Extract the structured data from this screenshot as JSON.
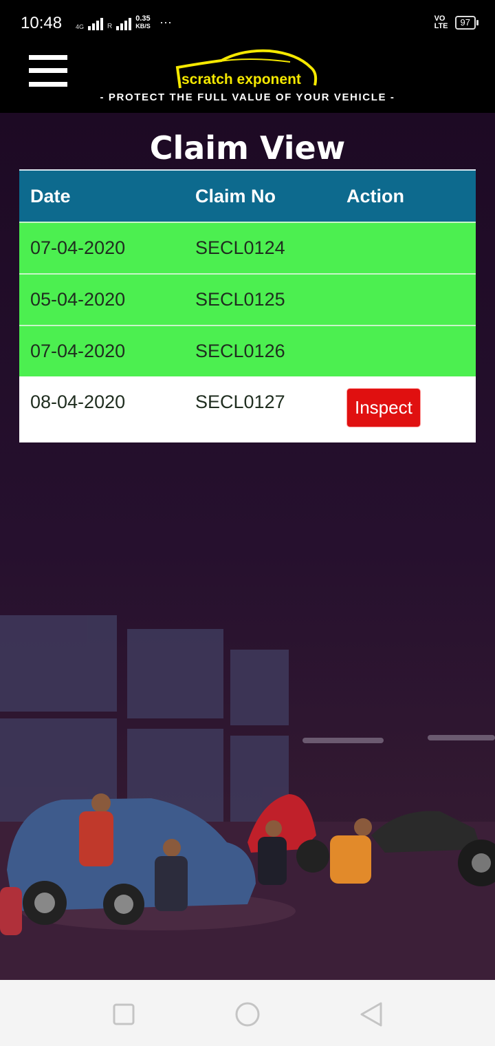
{
  "status_bar": {
    "time": "10:48",
    "network": "4G",
    "roaming": "R",
    "speed_value": "0.35",
    "speed_unit": "KB/S",
    "more": "···",
    "volte": "VO",
    "lte": "LTE",
    "battery": "97"
  },
  "header": {
    "logo_text": "scratch exponent",
    "tagline": "- PROTECT THE FULL VALUE OF YOUR VEHICLE -",
    "logo_color": "#f5e800"
  },
  "page": {
    "title": "Claim View"
  },
  "table": {
    "columns": [
      "Date",
      "Claim No",
      "Action"
    ],
    "rows": [
      {
        "date": "07-04-2020",
        "claim_no": "SECL0124",
        "action": ""
      },
      {
        "date": "05-04-2020",
        "claim_no": "SECL0125",
        "action": ""
      },
      {
        "date": "07-04-2020",
        "claim_no": "SECL0126",
        "action": ""
      },
      {
        "date": "08-04-2020",
        "claim_no": "SECL0127",
        "action": "Inspect"
      }
    ],
    "header_color": "#0d6a8e",
    "completed_row_color": "#4cef50",
    "action_button_color": "#e01010"
  },
  "nav_bar": {
    "icons": [
      "square-recents-icon",
      "circle-home-icon",
      "triangle-back-icon"
    ]
  }
}
